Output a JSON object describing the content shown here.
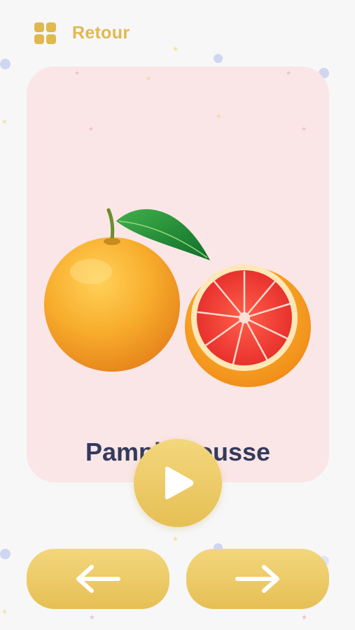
{
  "header": {
    "back_label": "Retour",
    "menu_icon": "grid-icon"
  },
  "card": {
    "word": "Pamplemousse",
    "image": "grapefruit-illustration"
  },
  "controls": {
    "play_icon": "play-icon",
    "prev_icon": "arrow-left-icon",
    "next_icon": "arrow-right-icon"
  },
  "colors": {
    "accent": "#e0b94e",
    "card_bg": "#fae6e6",
    "text": "#343a5c",
    "page_bg": "#f7f7f8"
  }
}
